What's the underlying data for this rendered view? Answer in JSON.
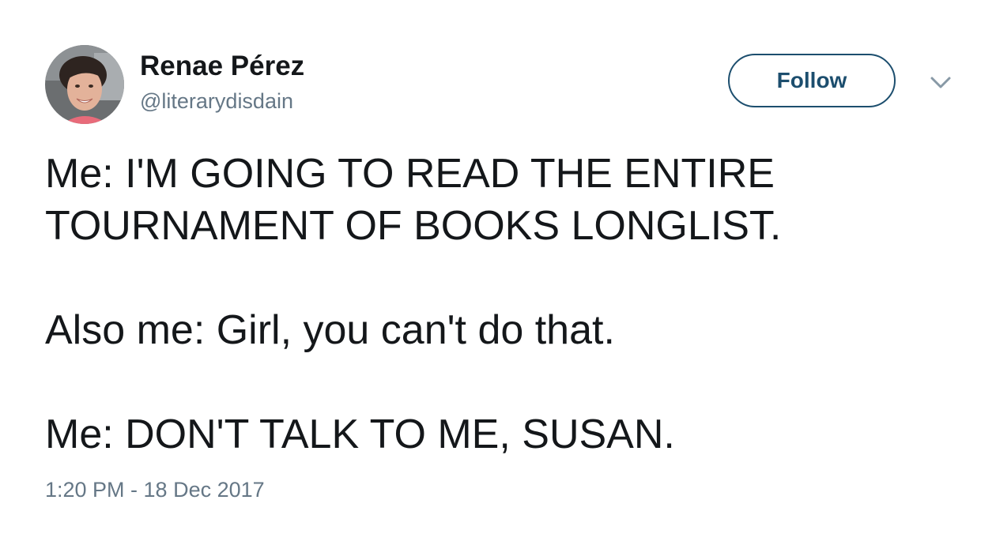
{
  "author": {
    "display_name": "Renae Pérez",
    "handle": "@literarydisdain",
    "avatar_icon": "profile-photo"
  },
  "actions": {
    "follow_label": "Follow",
    "menu_icon": "chevron-down-icon"
  },
  "tweet": {
    "lines": [
      "Me: I'M GOING TO READ THE ENTIRE TOURNAMENT OF BOOKS LONGLIST.",
      "Also me: Girl, you can't do that.",
      "Me: DON'T TALK TO ME, SUSAN."
    ],
    "timestamp": "1:20 PM - 18 Dec 2017"
  },
  "colors": {
    "text": "#14171a",
    "secondary_text": "#657786",
    "follow_border": "#1c4e6e"
  }
}
